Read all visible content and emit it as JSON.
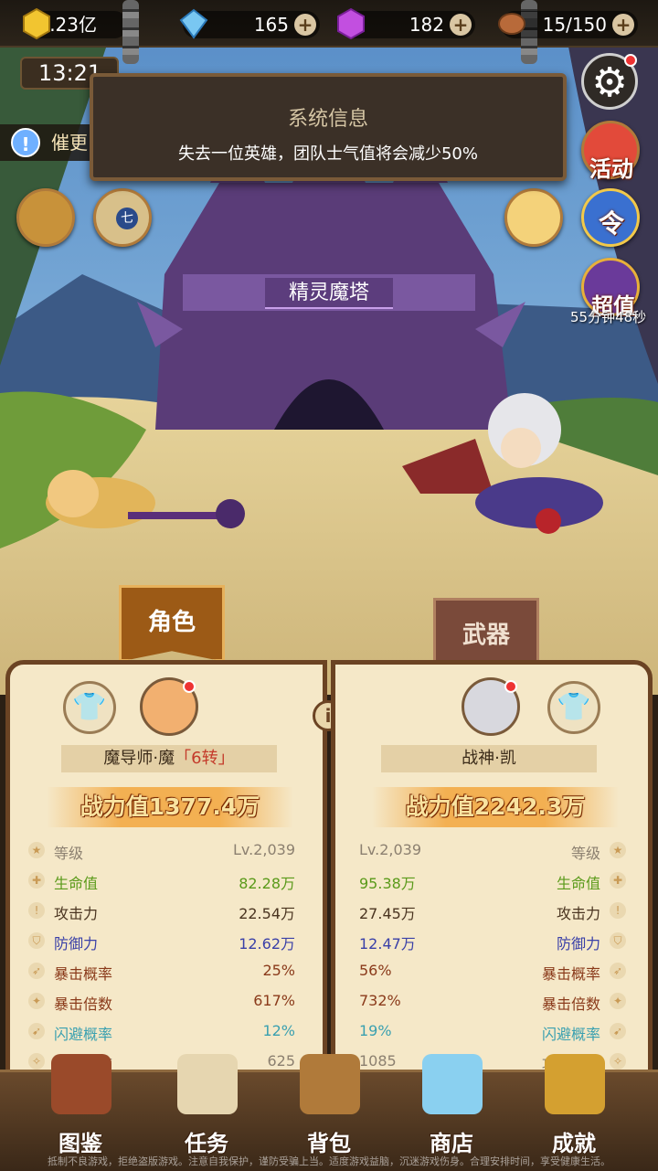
{
  "resources": {
    "gold": "6.23亿",
    "diamond": "165",
    "crystal": "182",
    "stamina": "15/150"
  },
  "clock": "13:21",
  "notice_label": "催更",
  "tower_title_partial": "精灵魔塔",
  "system_message": {
    "title": "系统信息",
    "message": "失去一位英雄，团队士气值将会减少50%"
  },
  "side_buttons": {
    "activity_label": "活动",
    "order_label": "令",
    "recharge_label": "超值",
    "recharge_timer": "55分钟48秒",
    "seven_label": "七"
  },
  "stage_name": "精灵魔塔",
  "tabs": {
    "role": "角色",
    "weapon": "武器"
  },
  "left_hero": {
    "name": "魔导师·魔",
    "tier": "「6转」",
    "power_label": "战力值",
    "power_value": "1377.4万",
    "stats": [
      {
        "label": "等级",
        "value": "Lv.2,039",
        "color": "grey"
      },
      {
        "label": "生命值",
        "value": "82.28万",
        "color": "green"
      },
      {
        "label": "攻击力",
        "value": "22.54万",
        "color": "brown"
      },
      {
        "label": "防御力",
        "value": "12.62万",
        "color": "blue"
      },
      {
        "label": "暴击概率",
        "value": "25%",
        "color": "rust"
      },
      {
        "label": "暴击倍数",
        "value": "617%",
        "color": "rust"
      },
      {
        "label": "闪避概率",
        "value": "12%",
        "color": "teal"
      },
      {
        "label": "攻击速度",
        "value": "625",
        "color": "grey"
      }
    ]
  },
  "right_hero": {
    "name": "战神·凯",
    "power_label": "战力值",
    "power_value": "2242.3万",
    "stats": [
      {
        "label": "等级",
        "value": "Lv.2,039",
        "color": "grey"
      },
      {
        "label": "生命值",
        "value": "95.38万",
        "color": "green"
      },
      {
        "label": "攻击力",
        "value": "27.45万",
        "color": "brown"
      },
      {
        "label": "防御力",
        "value": "12.47万",
        "color": "blue"
      },
      {
        "label": "暴击概率",
        "value": "56%",
        "color": "rust"
      },
      {
        "label": "暴击倍数",
        "value": "732%",
        "color": "rust"
      },
      {
        "label": "闪避概率",
        "value": "19%",
        "color": "teal"
      },
      {
        "label": "攻击速度",
        "value": "1085",
        "color": "grey"
      }
    ]
  },
  "nav": {
    "items": [
      {
        "label": "图鉴"
      },
      {
        "label": "任务"
      },
      {
        "label": "背包"
      },
      {
        "label": "商店"
      },
      {
        "label": "成就"
      }
    ]
  },
  "footer": "抵制不良游戏，拒绝盗版游戏。注意自我保护，谨防受骗上当。适度游戏益脑，沉迷游戏伤身。合理安排时间，享受健康生活。"
}
